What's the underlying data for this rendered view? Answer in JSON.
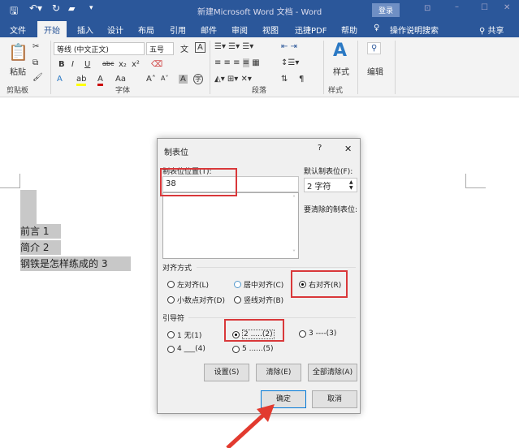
{
  "window": {
    "title": "新建Microsoft Word 文档 - Word",
    "login": "登录"
  },
  "qat": {
    "save": "save-icon",
    "undo": "undo-icon",
    "redo": "redo-icon",
    "open": "open-icon",
    "more": "▾"
  },
  "tabs": [
    "文件",
    "开始",
    "插入",
    "设计",
    "布局",
    "引用",
    "邮件",
    "审阅",
    "视图",
    "迅捷PDF",
    "帮助"
  ],
  "tell_me": "操作说明搜索",
  "share": "共享",
  "ribbon": {
    "clipboard": {
      "paste": "粘贴",
      "label": "剪贴板"
    },
    "font": {
      "name": "等线 (中文正文)",
      "size": "五号",
      "label": "字体",
      "bold": "B",
      "italic": "I",
      "underline": "U",
      "strike": "abc",
      "sub": "x₂",
      "sup": "x²",
      "case": "Aa",
      "grow": "A˄",
      "shrink": "A˅"
    },
    "paragraph": {
      "label": "段落"
    },
    "styles": {
      "button": "样式",
      "label": "样式"
    },
    "editing": {
      "button": "编辑"
    }
  },
  "document": {
    "lines": [
      "前言 1",
      "简介 2",
      "钢铁是怎样练成的 3"
    ]
  },
  "dialog": {
    "title": "制表位",
    "help": "?",
    "close": "✕",
    "tab_position_label": "制表位位置(T):",
    "tab_position_value": "38",
    "default_label": "默认制表位(F):",
    "default_value": "2 字符",
    "clear_label": "要清除的制表位:",
    "alignment_label": "对齐方式",
    "alignment": [
      {
        "label": "左对齐(L)",
        "checked": false
      },
      {
        "label": "居中对齐(C)",
        "checked": false
      },
      {
        "label": "右对齐(R)",
        "checked": true
      },
      {
        "label": "小数点对齐(D)",
        "checked": false
      },
      {
        "label": "竖线对齐(B)",
        "checked": false
      }
    ],
    "leader_label": "引导符",
    "leader": [
      {
        "label": "1 无(1)",
        "checked": false
      },
      {
        "label": "2 .....(2)",
        "checked": true
      },
      {
        "label": "3 ----(3)",
        "checked": false
      },
      {
        "label": "4 ___(4)",
        "checked": false
      },
      {
        "label": "5 ......(5)",
        "checked": false
      }
    ],
    "set": "设置(S)",
    "clear": "清除(E)",
    "clear_all": "全部清除(A)",
    "ok": "确定",
    "cancel": "取消"
  },
  "colors": {
    "accent": "#2b579a",
    "highlight": "#d9383a"
  }
}
